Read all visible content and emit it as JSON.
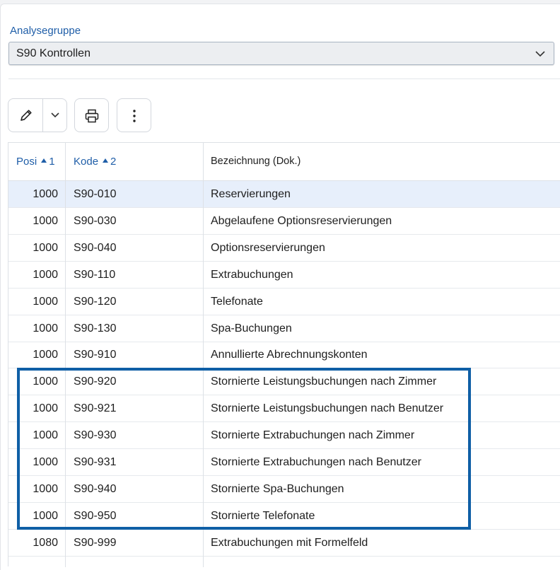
{
  "filter": {
    "label": "Analysegruppe",
    "value": "S90 Kontrollen"
  },
  "toolbar": {
    "edit_icon": "pencil-icon",
    "dropdown_icon": "chevron-down-icon",
    "print_icon": "printer-icon",
    "more_icon": "more-vertical-icon"
  },
  "grid": {
    "columns": [
      {
        "label": "Posi",
        "sort_order": "1",
        "sorted": "ascending"
      },
      {
        "label": "Kode",
        "sort_order": "2",
        "sorted": "ascending"
      },
      {
        "label": "Bezeichnung (Dok.)"
      }
    ],
    "rows": [
      {
        "pos": "1000",
        "kode": "S90-010",
        "bez": "Reservierungen"
      },
      {
        "pos": "1000",
        "kode": "S90-030",
        "bez": "Abgelaufene Optionsreservierungen"
      },
      {
        "pos": "1000",
        "kode": "S90-040",
        "bez": "Optionsreservierungen"
      },
      {
        "pos": "1000",
        "kode": "S90-110",
        "bez": "Extrabuchungen"
      },
      {
        "pos": "1000",
        "kode": "S90-120",
        "bez": "Telefonate"
      },
      {
        "pos": "1000",
        "kode": "S90-130",
        "bez": "Spa-Buchungen"
      },
      {
        "pos": "1000",
        "kode": "S90-910",
        "bez": "Annullierte Abrechnungskonten"
      },
      {
        "pos": "1000",
        "kode": "S90-920",
        "bez": "Stornierte Leistungsbuchungen nach Zimmer"
      },
      {
        "pos": "1000",
        "kode": "S90-921",
        "bez": "Stornierte Leistungsbuchungen nach Benutzer"
      },
      {
        "pos": "1000",
        "kode": "S90-930",
        "bez": "Stornierte Extrabuchungen nach Zimmer"
      },
      {
        "pos": "1000",
        "kode": "S90-931",
        "bez": "Stornierte Extrabuchungen nach Benutzer"
      },
      {
        "pos": "1000",
        "kode": "S90-940",
        "bez": "Stornierte Spa-Buchungen"
      },
      {
        "pos": "1000",
        "kode": "S90-950",
        "bez": "Stornierte Telefonate"
      },
      {
        "pos": "1080",
        "kode": "S90-999",
        "bez": "Extrabuchungen mit Formelfeld"
      }
    ]
  },
  "colors": {
    "accent": "#1f5ea8",
    "highlight_border": "#0f5fa6",
    "selected_row": "#e7effb"
  }
}
